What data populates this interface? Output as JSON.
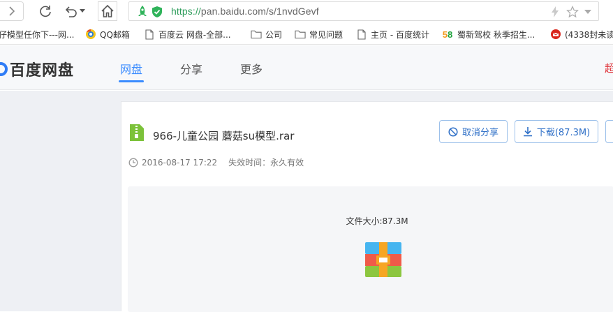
{
  "browser": {
    "url_scheme": "https://",
    "url_rest": "pan.baidu.com/s/1nvdGevf"
  },
  "bookmarks": [
    {
      "label": "仔模型任你下---网...",
      "icon": "page-icon"
    },
    {
      "label": "QQ邮箱",
      "icon": "qq-mail-icon"
    },
    {
      "label": "百度云  网盘-全部...",
      "icon": "document-icon"
    },
    {
      "label": "公司",
      "icon": "folder-icon"
    },
    {
      "label": "常见问题",
      "icon": "folder-icon"
    },
    {
      "label": "主页 - 百度统计",
      "icon": "document-icon"
    },
    {
      "label": "蜀新驾校  秋季招生...",
      "icon": "58-icon"
    },
    {
      "label": "(4338封未读",
      "icon": "mail-icon"
    }
  ],
  "site": {
    "logo_text": "百度网盘",
    "nav": [
      {
        "label": "网盘",
        "active": true
      },
      {
        "label": "分享",
        "active": false
      },
      {
        "label": "更多",
        "active": false
      }
    ],
    "header_right_text": "超"
  },
  "share": {
    "file_name": "966-儿童公园 蘑菇su模型.rar",
    "date": "2016-08-17 17:22",
    "expiry": "失效时间：永久有效",
    "cancel_share_label": "取消分享",
    "download_label": "下载(87.3M)",
    "file_size_text": "文件大小:87.3M"
  },
  "colors": {
    "accent": "#3b8cff",
    "button_text": "#2e6fc7",
    "header_alert": "#e0383e"
  }
}
